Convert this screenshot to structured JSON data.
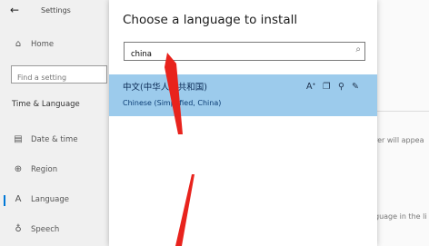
{
  "window": {
    "title": "Settings"
  },
  "sidebar": {
    "back_icon": "←",
    "home": {
      "label": "Home",
      "icon": "home-icon"
    },
    "search_placeholder": "Find a setting",
    "section_title": "Time & Language",
    "items": [
      {
        "label": "Date & time",
        "icon": "calendar-icon",
        "glyph": "▤"
      },
      {
        "label": "Region",
        "icon": "globe-icon",
        "glyph": "⊕"
      },
      {
        "label": "Language",
        "icon": "language-icon",
        "glyph": "A"
      },
      {
        "label": "Speech",
        "icon": "microphone-icon",
        "glyph": "♁"
      }
    ],
    "active_item": "Language"
  },
  "background": {
    "text1": "rer will appea",
    "text2": "guage in the li"
  },
  "dialog": {
    "title": "Choose a language to install",
    "search_value": "china",
    "search_icon": "⌕",
    "results": [
      {
        "name": "中文(中华人民共和国)",
        "subtitle": "Chinese (Simplified, China)",
        "features": [
          "text-to-speech-icon",
          "display-language-icon",
          "speech-recognition-icon",
          "handwriting-icon"
        ]
      }
    ]
  },
  "annotation": {
    "arrow_color": "#e8231d"
  },
  "colors": {
    "selection": "#9ccbec",
    "accent": "#0078d7"
  }
}
